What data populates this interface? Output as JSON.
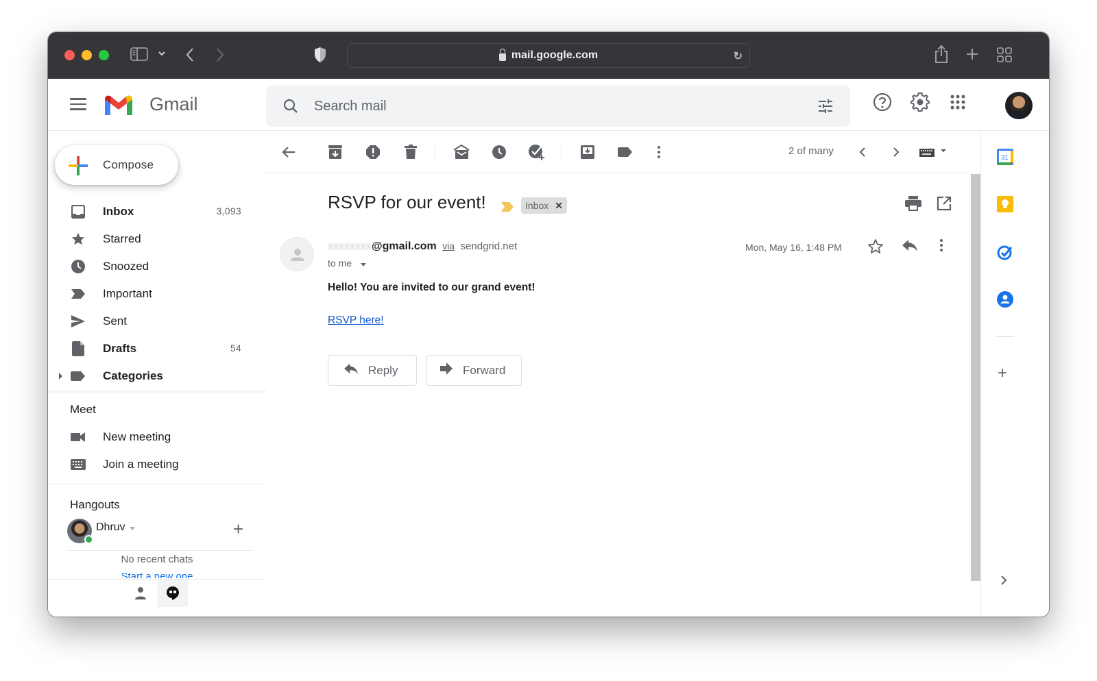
{
  "browser": {
    "url": "mail.google.com"
  },
  "app": {
    "name": "Gmail",
    "search_placeholder": "Search mail"
  },
  "sidebar": {
    "compose_label": "Compose",
    "items": [
      {
        "label": "Inbox",
        "count": "3,093",
        "bold": true,
        "icon": "inbox-icon"
      },
      {
        "label": "Starred",
        "count": "",
        "bold": false,
        "icon": "star-icon"
      },
      {
        "label": "Snoozed",
        "count": "",
        "bold": false,
        "icon": "clock-icon"
      },
      {
        "label": "Important",
        "count": "",
        "bold": false,
        "icon": "important-icon"
      },
      {
        "label": "Sent",
        "count": "",
        "bold": false,
        "icon": "send-icon"
      },
      {
        "label": "Drafts",
        "count": "54",
        "bold": true,
        "icon": "draft-icon"
      },
      {
        "label": "Categories",
        "count": "",
        "bold": true,
        "icon": "label-icon"
      }
    ],
    "meet": {
      "title": "Meet",
      "items": [
        {
          "label": "New meeting",
          "icon": "video-camera-icon"
        },
        {
          "label": "Join a meeting",
          "icon": "keyboard-icon"
        }
      ]
    },
    "hangouts": {
      "title": "Hangouts",
      "user": "Dhruv",
      "status": "online",
      "no_chats": "No recent chats",
      "start_new": "Start a new one"
    }
  },
  "toolbar": {
    "pager": "2 of many",
    "actions": [
      "back",
      "archive",
      "report-spam",
      "delete",
      "mark-unread",
      "snooze",
      "add-to-tasks",
      "move-to",
      "labels",
      "more"
    ]
  },
  "message": {
    "subject": "RSVP for our event!",
    "label": "Inbox",
    "sender_hidden": "xxxxxxxx",
    "sender_domain": "@gmail.com",
    "via_label": "via",
    "via_domain": "sendgrid.net",
    "recipient": "to me",
    "date": "Mon, May 16, 1:48 PM",
    "body": "Hello! You are invited to our grand event!",
    "link_text": "RSVP here!",
    "reply_label": "Reply",
    "forward_label": "Forward"
  },
  "side_panel": {
    "calendar_day": "31",
    "apps": [
      "calendar",
      "keep",
      "tasks",
      "contacts"
    ]
  },
  "colors": {
    "red": "#ea4335",
    "blue": "#4285f4",
    "yellow": "#fbbc04",
    "green": "#34a853",
    "link": "#1155cc"
  }
}
